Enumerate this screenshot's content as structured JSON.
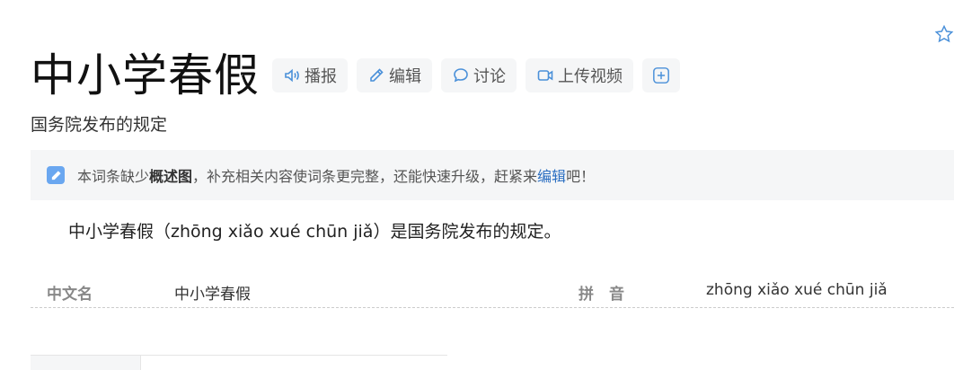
{
  "title": "中小学春假",
  "toolbar": {
    "play_label": "播报",
    "edit_label": "编辑",
    "discuss_label": "讨论",
    "upload_video_label": "上传视频"
  },
  "subtitle": "国务院发布的规定",
  "notice": {
    "prefix": "本词条缺少",
    "bold": "概述图",
    "middle": "，补充相关内容使词条更完整，还能快速升级，赶紧来",
    "link": "编辑",
    "suffix": "吧！"
  },
  "summary": "中小学春假（zhōng xiǎo xué chūn jiǎ）是国务院发布的规定。",
  "info": {
    "cn_name_key": "中文名",
    "cn_name_value": "中小学春假",
    "pinyin_key": "拼　音",
    "pinyin_value": "zhōng xiǎo xué chūn jiǎ"
  },
  "icons": [
    "star-icon",
    "speaker-icon",
    "pencil-icon",
    "chat-bubble-icon",
    "video-camera-icon",
    "plus-icon"
  ],
  "colors": {
    "accent": "#4a90d9",
    "link": "#2a6ec1",
    "button_bg": "#f5f6f7"
  }
}
